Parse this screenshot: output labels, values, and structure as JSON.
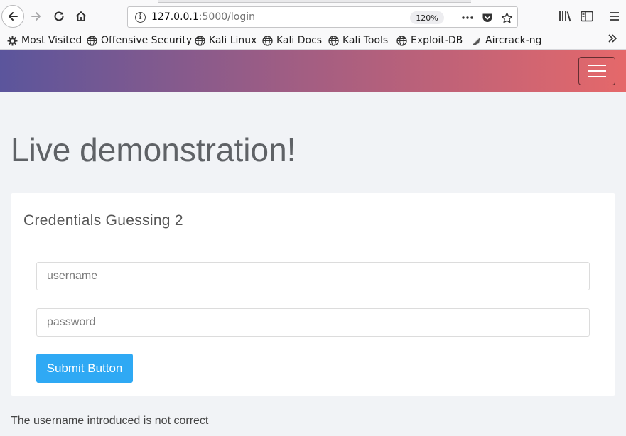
{
  "browser": {
    "url_host": "127.0.0.1",
    "url_rest": ":5000/login",
    "zoom": "120%"
  },
  "bookmarks": [
    {
      "label": "Most Visited",
      "icon": "gear-icon"
    },
    {
      "label": "Offensive Security",
      "icon": "globe-icon"
    },
    {
      "label": "Kali Linux",
      "icon": "globe-icon"
    },
    {
      "label": "Kali Docs",
      "icon": "globe-icon"
    },
    {
      "label": "Kali Tools",
      "icon": "globe-icon"
    },
    {
      "label": "Exploit-DB",
      "icon": "globe-icon"
    },
    {
      "label": "Aircrack-ng",
      "icon": "aircrack-icon"
    }
  ],
  "page": {
    "heading": "Live demonstration!",
    "card_title": "Credentials Guessing 2",
    "username_placeholder": "username",
    "password_placeholder": "password",
    "submit_label": "Submit Button",
    "message": "The username introduced is not correct"
  },
  "colors": {
    "navbar_gradient": [
      "#5b559c",
      "#e5686a"
    ],
    "submit": "#2fa9f4"
  }
}
